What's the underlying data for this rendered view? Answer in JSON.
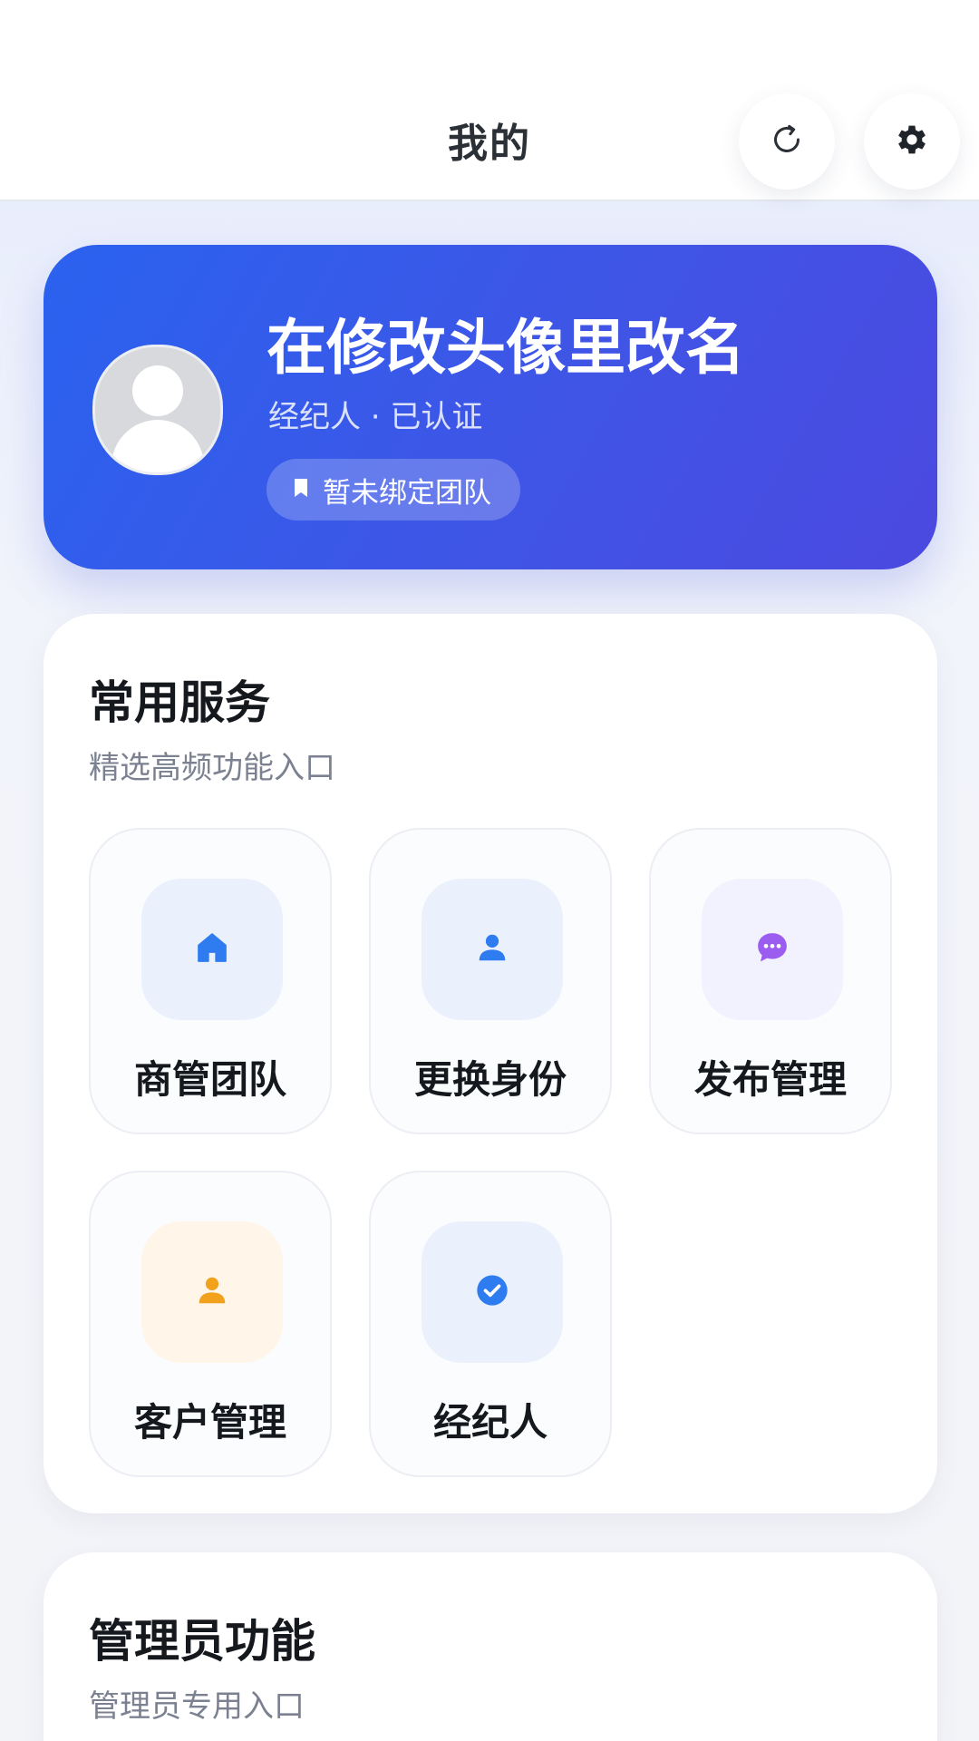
{
  "header": {
    "title": "我的",
    "refresh_icon": "refresh-icon",
    "settings_icon": "gear-icon"
  },
  "profile": {
    "name": "在修改头像里改名",
    "subtitle": "经纪人 · 已认证",
    "team_chip": "暂未绑定团队",
    "team_chip_icon": "bookmark-icon",
    "avatar_icon": "avatar-placeholder"
  },
  "services": {
    "title": "常用服务",
    "subtitle": "精选高频功能入口",
    "items": [
      {
        "label": "商管团队",
        "icon": "home-icon",
        "color": "#2f7cf0"
      },
      {
        "label": "更换身份",
        "icon": "user-icon",
        "color": "#2f7cf0"
      },
      {
        "label": "发布管理",
        "icon": "chat-icon",
        "color": "#9b5cf0"
      },
      {
        "label": "客户管理",
        "icon": "user-icon",
        "color": "#f2a11c"
      },
      {
        "label": "经纪人",
        "icon": "check-circle-icon",
        "color": "#2f7cf0"
      }
    ]
  },
  "admin": {
    "title": "管理员功能",
    "subtitle": "管理员专用入口"
  },
  "colors": {
    "accent": "#3d5be9",
    "text_primary": "#15181d",
    "text_secondary": "#7b8190"
  }
}
